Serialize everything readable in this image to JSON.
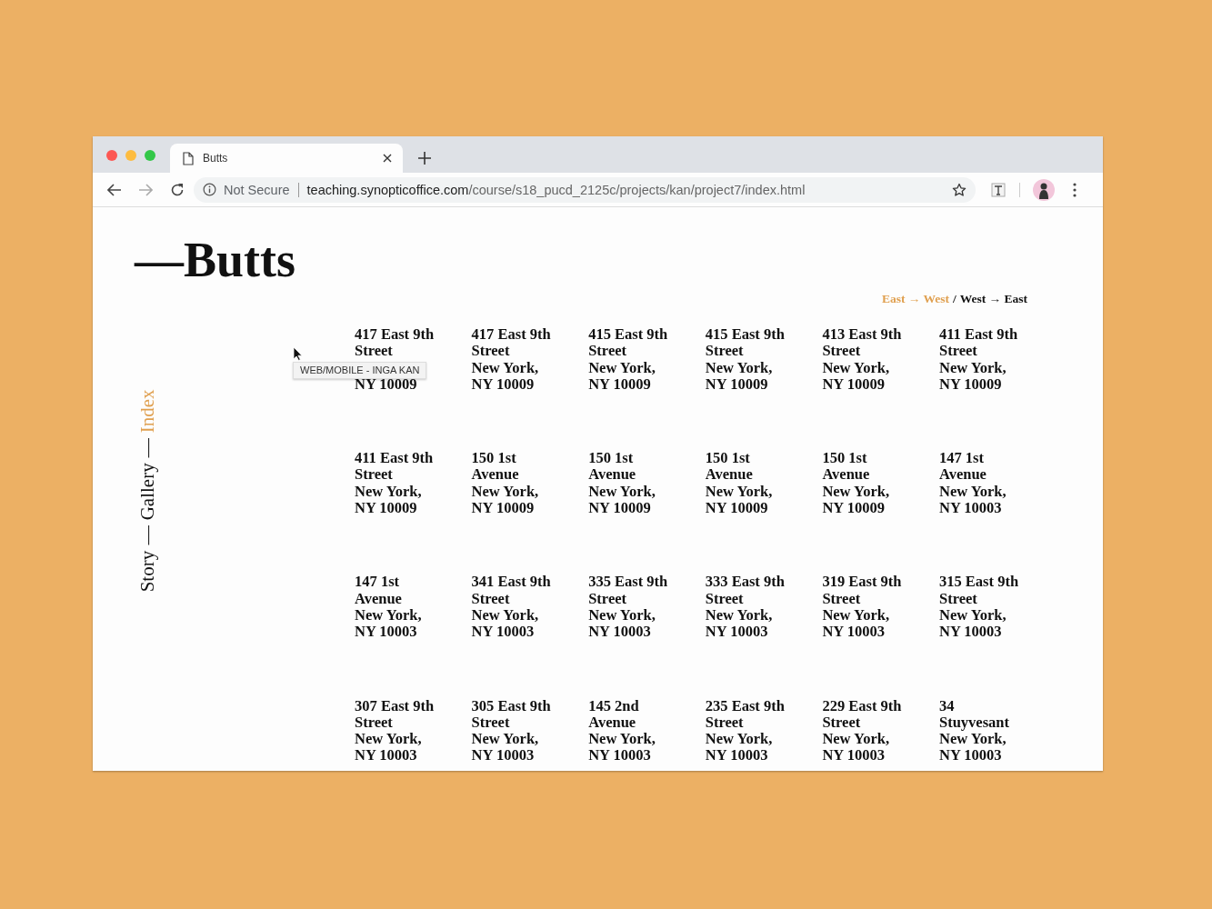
{
  "browser": {
    "tab": {
      "title": "Butts"
    },
    "security": "Not Secure",
    "url_host": "teaching.synopticoffice.com",
    "url_path": "/course/s18_pucd_2125c/projects/kan/project7/index.html"
  },
  "page": {
    "title": "—Butts",
    "sort": {
      "separator": "/",
      "options": [
        {
          "label": "East → West",
          "selected": true
        },
        {
          "label": "West → East",
          "selected": false
        }
      ]
    },
    "nav": {
      "separator": "—",
      "items": [
        {
          "label": "Story",
          "selected": false
        },
        {
          "label": "Gallery",
          "selected": false
        },
        {
          "label": "Index",
          "selected": true
        }
      ]
    },
    "tooltip": "WEB/MOBILE - INGA KAN",
    "addresses": [
      {
        "street": [
          "417 East 9th",
          "Street"
        ],
        "zip": "NY 10009"
      },
      {
        "street": [
          "417 East 9th",
          "Street"
        ],
        "city": "New York,",
        "zip": "NY 10009"
      },
      {
        "street": [
          "415 East 9th",
          "Street"
        ],
        "city": "New York,",
        "zip": "NY 10009"
      },
      {
        "street": [
          "415 East 9th",
          "Street"
        ],
        "city": "New York,",
        "zip": "NY 10009"
      },
      {
        "street": [
          "413 East 9th",
          "Street"
        ],
        "city": "New York,",
        "zip": "NY 10009"
      },
      {
        "street": [
          "411 East 9th",
          "Street"
        ],
        "city": "New York,",
        "zip": "NY 10009"
      },
      {
        "street": [
          "411 East 9th",
          "Street"
        ],
        "city": "New York,",
        "zip": "NY 10009"
      },
      {
        "street": [
          "150 1st",
          "Avenue"
        ],
        "city": "New York,",
        "zip": "NY 10009"
      },
      {
        "street": [
          "150 1st",
          "Avenue"
        ],
        "city": "New York,",
        "zip": "NY 10009"
      },
      {
        "street": [
          "150 1st",
          "Avenue"
        ],
        "city": "New York,",
        "zip": "NY 10009"
      },
      {
        "street": [
          "150 1st",
          "Avenue"
        ],
        "city": "New York,",
        "zip": "NY 10009"
      },
      {
        "street": [
          "147 1st",
          "Avenue"
        ],
        "city": "New York,",
        "zip": "NY 10003"
      },
      {
        "street": [
          "147 1st",
          "Avenue"
        ],
        "city": "New York,",
        "zip": "NY 10003"
      },
      {
        "street": [
          "341 East 9th",
          "Street"
        ],
        "city": "New York,",
        "zip": "NY 10003"
      },
      {
        "street": [
          "335 East 9th",
          "Street"
        ],
        "city": "New York,",
        "zip": "NY 10003"
      },
      {
        "street": [
          "333 East 9th",
          "Street"
        ],
        "city": "New York,",
        "zip": "NY 10003"
      },
      {
        "street": [
          "319 East 9th",
          "Street"
        ],
        "city": "New York,",
        "zip": "NY 10003"
      },
      {
        "street": [
          "315 East 9th",
          "Street"
        ],
        "city": "New York,",
        "zip": "NY 10003"
      },
      {
        "street": [
          "307 East 9th",
          "Street"
        ],
        "city": "New York,",
        "zip": "NY 10003"
      },
      {
        "street": [
          "305 East 9th",
          "Street"
        ],
        "city": "New York,",
        "zip": "NY 10003"
      },
      {
        "street": [
          "145 2nd",
          "Avenue"
        ],
        "city": "New York,",
        "zip": "NY 10003"
      },
      {
        "street": [
          "235 East 9th",
          "Street"
        ],
        "city": "New York,",
        "zip": "NY 10003"
      },
      {
        "street": [
          "229 East 9th",
          "Street"
        ],
        "city": "New York,",
        "zip": "NY 10003"
      },
      {
        "street": [
          "34",
          "Stuyvesant"
        ],
        "city": "New York,",
        "zip": "NY 10003"
      }
    ]
  }
}
